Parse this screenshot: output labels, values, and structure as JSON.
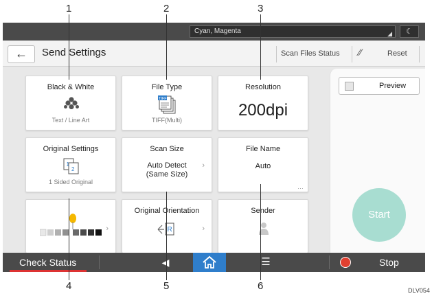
{
  "callouts": [
    "1",
    "2",
    "3",
    "4",
    "5",
    "6"
  ],
  "topbar": {
    "message": "Cyan, Magenta"
  },
  "header": {
    "title": "Send Settings",
    "scan_files_status": "Scan Files Status",
    "reset": "Reset"
  },
  "tiles": {
    "color": {
      "title": "Black & White",
      "sub": "Text / Line Art"
    },
    "file_type": {
      "title": "File Type",
      "sub": "TIFF(Multi)",
      "icon_label": "TIFF"
    },
    "resolution": {
      "title": "Resolution",
      "value": "200dpi"
    },
    "original_settings": {
      "title": "Original Settings",
      "sub": "1 Sided Original",
      "icon_num_1": "1",
      "icon_num_2": "2"
    },
    "scan_size": {
      "title": "Scan Size",
      "value": "Auto Detect\n(Same Size)"
    },
    "file_name": {
      "title": "File Name",
      "value": "Auto"
    },
    "original_orientation": {
      "title": "Original Orientation"
    },
    "sender": {
      "title": "Sender"
    }
  },
  "right_panel": {
    "preview": "Preview",
    "start": "Start"
  },
  "bottom_bar": {
    "check_status": "Check Status",
    "stop": "Stop"
  },
  "footer_code": "DLV054",
  "colors": {
    "accent_blue": "#2f7ecb",
    "start_teal": "#a8ddd1",
    "stop_red": "#e04030",
    "bar_gray": "#4a4a4a"
  }
}
